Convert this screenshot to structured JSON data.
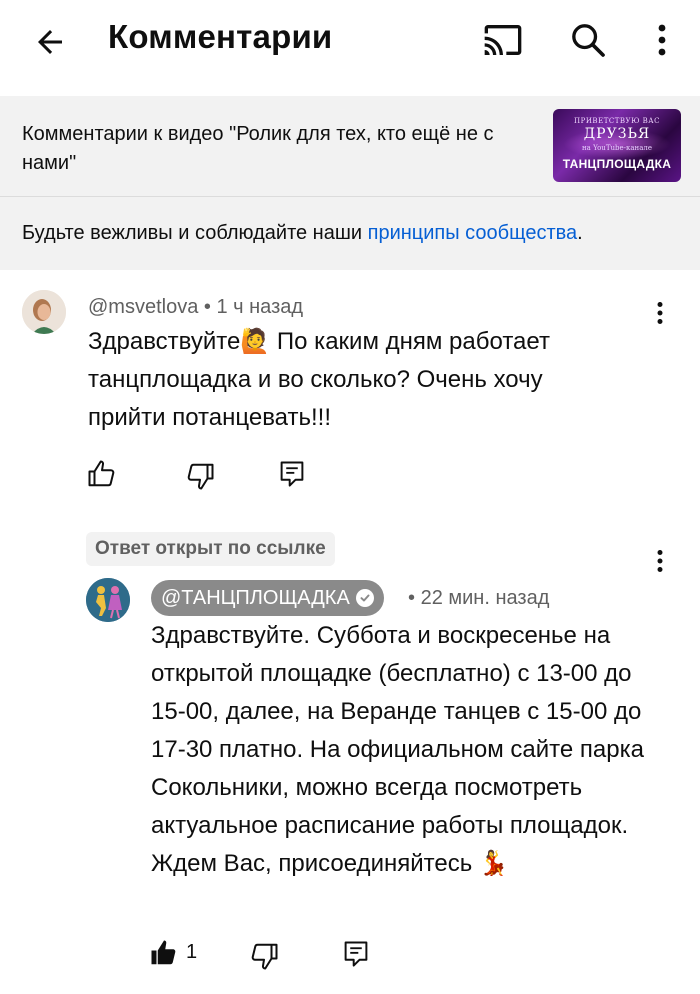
{
  "header": {
    "title": "Комментарии",
    "back_icon": "arrow-left-icon",
    "cast_icon": "cast-icon",
    "search_icon": "search-icon",
    "more_icon": "more-vertical-icon"
  },
  "video_context": {
    "text": "Комментарии к видео \"Ролик для тех, кто ещё не с нами\"",
    "thumbnail": {
      "line1": "ПРИВЕТСТВУЮ ВАС",
      "line2": "ДРУЗЬЯ",
      "line3": "на YouTube-канале",
      "line4": "ТАНЦПЛОЩАДКА"
    }
  },
  "guidelines": {
    "prefix": "Будьте вежливы и соблюдайте наши ",
    "link": "принципы сообщества",
    "suffix": "."
  },
  "comment": {
    "author": "@msvetlova",
    "separator": "•",
    "time": "1 ч назад",
    "text": "Здравствуйте🙋 По каким дням работает танцплощадка и во сколько? Очень хочу прийти потанцевать!!!"
  },
  "reply": {
    "chip": "Ответ открыт по ссылке",
    "author": "@ТАНЦПЛОЩАДКА",
    "separator": "•",
    "time": "22 мин. назад",
    "text": "Здравствуйте. Суббота и воскресенье на открытой площадке (бесплатно) с 13-00 до 15-00, далее, на Веранде танцев с 15-00 до 17-30 платно. На официальном сайте парка Сокольники, можно всегда посмотреть актуальное расписание работы площадок. Ждем Вас, присоединяйтесь 💃",
    "like_count": "1"
  },
  "colors": {
    "link": "#065fd4",
    "panel_bg": "#f2f2f2",
    "meta": "#606060"
  }
}
